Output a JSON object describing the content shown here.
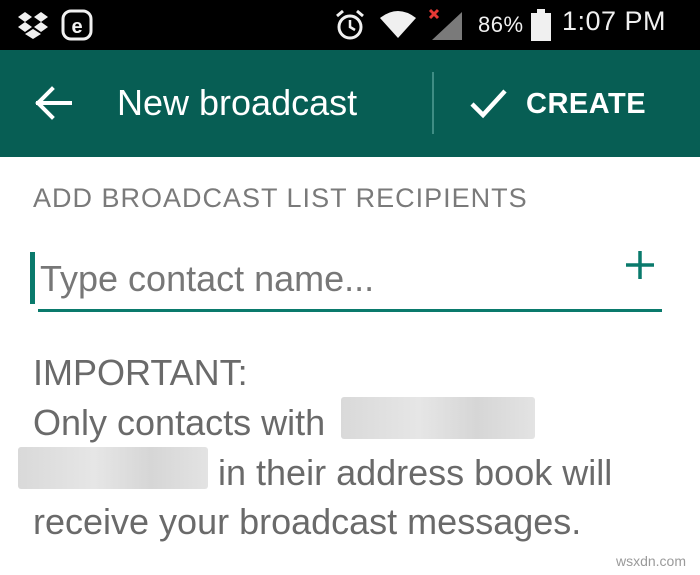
{
  "status_bar": {
    "battery_percent": "86%",
    "time": "1:07 PM",
    "icons": [
      "dropbox-icon",
      "e-app-icon",
      "alarm-icon",
      "wifi-icon",
      "signal-no-service-icon",
      "battery-icon"
    ]
  },
  "app_bar": {
    "title": "New broadcast",
    "create_label": "CREATE",
    "color": "#075e54"
  },
  "form": {
    "section_label": "ADD BROADCAST LIST RECIPIENTS",
    "contact_placeholder": "Type contact name...",
    "accent": "#0a7a6c"
  },
  "notice": {
    "heading": "IMPORTANT:",
    "text_1": "Only contacts with",
    "text_2": "in their address book will",
    "text_3": "receive your broadcast messages."
  },
  "watermark": "wsxdn.com"
}
